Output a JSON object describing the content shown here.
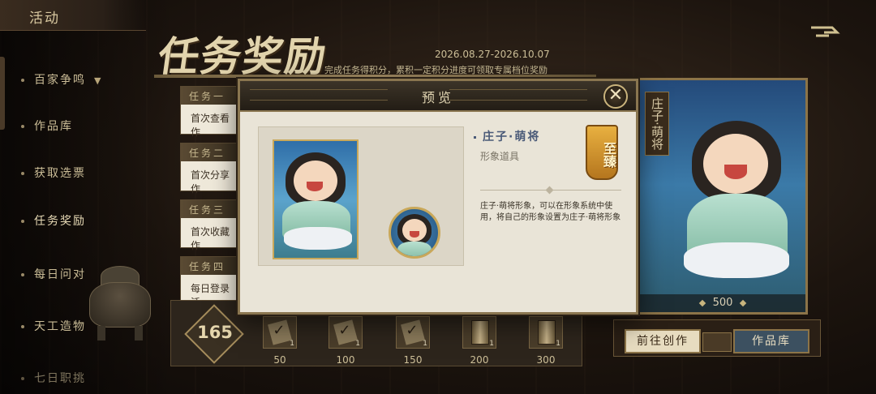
{
  "header": {
    "section_label": "活动"
  },
  "sidebar": {
    "items": [
      {
        "label": "百家争鸣",
        "has_chevron": true
      },
      {
        "label": "作品库"
      },
      {
        "label": "获取选票"
      },
      {
        "label": "任务奖励",
        "active": true
      },
      {
        "label": "每日问对"
      },
      {
        "label": "天工造物"
      },
      {
        "label": "七日职挑"
      }
    ]
  },
  "event": {
    "title": "任务奖励",
    "date_range": "2026.08.27-2026.10.07",
    "description": "完成任务得积分，累积一定积分进度可领取专属档位奖励",
    "back_icon": "back-arrow-icon"
  },
  "tasks": [
    {
      "head": "任务一",
      "body": "首次查看作"
    },
    {
      "head": "任务二",
      "body": "首次分享作"
    },
    {
      "head": "任务三",
      "body": "首次收藏作"
    },
    {
      "head": "任务四",
      "body": "每日登录活"
    }
  ],
  "right_card": {
    "vertical_label": "庄子·萌将",
    "price": "500"
  },
  "progress": {
    "score": "165",
    "milestones": [
      {
        "points": "50",
        "count": "1",
        "claimed": true
      },
      {
        "points": "100",
        "count": "1",
        "claimed": true
      },
      {
        "points": "150",
        "count": "1",
        "claimed": true
      },
      {
        "points": "200",
        "count": "1",
        "claimed": false
      },
      {
        "points": "300",
        "count": "1",
        "claimed": false
      }
    ]
  },
  "actions": {
    "create_label": "前往创作",
    "works_label": "作品库"
  },
  "modal": {
    "title": "预览",
    "close_icon": "close-icon",
    "item_name": "庄子·萌将",
    "item_type": "形象道具",
    "rarity": "至臻",
    "description": "庄子·萌将形象，可以在形象系统中使用，将自己的形象设置为庄子·萌将形象"
  },
  "colors": {
    "frame_gold": "#8a7650",
    "rarity_gold": "#e8b040",
    "panel_paper": "#e9e4d7",
    "accent_blue": "#4a5a78"
  }
}
